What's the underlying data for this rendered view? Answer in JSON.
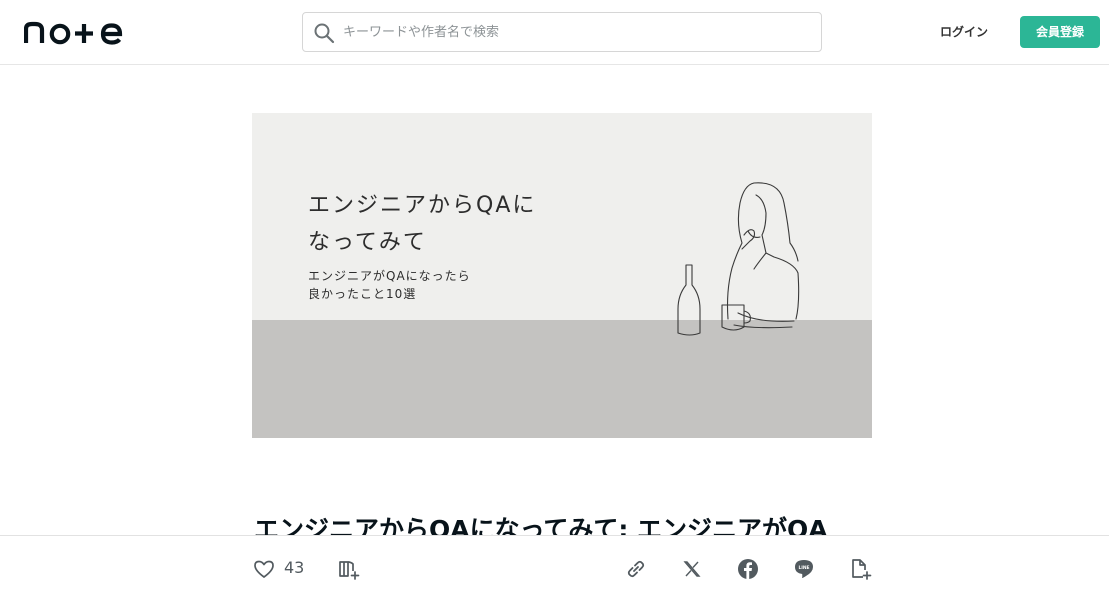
{
  "header": {
    "logo_text": "note",
    "search": {
      "placeholder": "キーワードや作者名で検索",
      "value": ""
    },
    "login_label": "ログイン",
    "signup_label": "会員登録",
    "accent_color": "#2cb696"
  },
  "hero": {
    "title": "エンジニアからQAに\nなってみて",
    "subtitle": "エンジニアがQAになったら\n良かったこと10選"
  },
  "article": {
    "title": "エンジニアからQAになってみて: エンジニアがQA"
  },
  "actions": {
    "like_count": "43",
    "icons": [
      "heart-icon",
      "magazine-add-icon",
      "link-icon",
      "x-icon",
      "facebook-icon",
      "line-icon",
      "note-add-icon"
    ]
  }
}
